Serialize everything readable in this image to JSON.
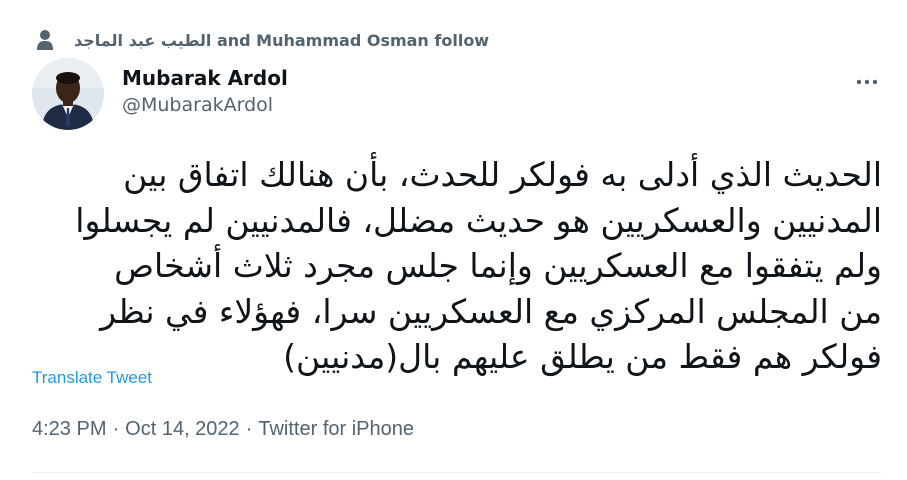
{
  "social_context": {
    "icon": "person-icon",
    "names_arabic": "الطيب عبد الماجد",
    "names_rest": " and Muhammad Osman follow"
  },
  "author": {
    "display_name": "Mubarak Ardol",
    "handle": "@MubarakArdol"
  },
  "tweet": {
    "text": "الحديث الذي أدلى به فولكر للحدث، بأن هنالك اتفاق بين\nالمدنيين والعسكريين هو حديث مضلل، فالمدنيين لم يجسلوا\nولم يتفقوا مع العسكريين وإنما جلس مجرد ثلاث أشخاص\nمن المجلس المركزي مع العسكريين سرا، فهؤلاء في نظر\nفولكر هم فقط من يطلق عليهم بال(مدنيين)"
  },
  "translate_label": "Translate Tweet",
  "meta": {
    "time": "4:23 PM",
    "separator": "·",
    "date": "Oct 14, 2022",
    "source": "Twitter for iPhone"
  },
  "colors": {
    "text": "#0f1419",
    "secondary": "#536471",
    "link": "#1d9bf0",
    "divider": "#eff3f4"
  }
}
